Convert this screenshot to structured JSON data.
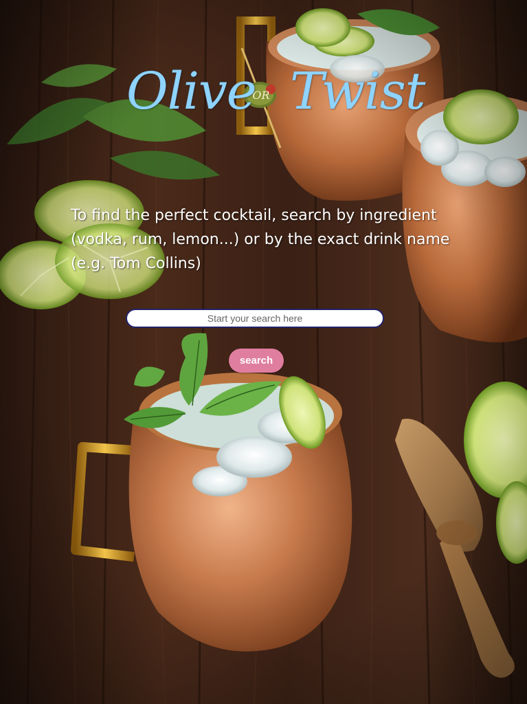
{
  "logo": {
    "word_left": "Olive",
    "word_middle": "OR",
    "word_right": "Twist"
  },
  "tagline": "To find the perfect cocktail, search by ingredient (vodka, rum, lemon...) or by the exact drink name (e.g. Tom Collins)",
  "search": {
    "placeholder": "Start your search here",
    "value": "",
    "button_label": "search"
  },
  "colors": {
    "logo_text": "#8fd3ff",
    "button_bg": "#e07ea0",
    "input_border": "#22226b"
  }
}
